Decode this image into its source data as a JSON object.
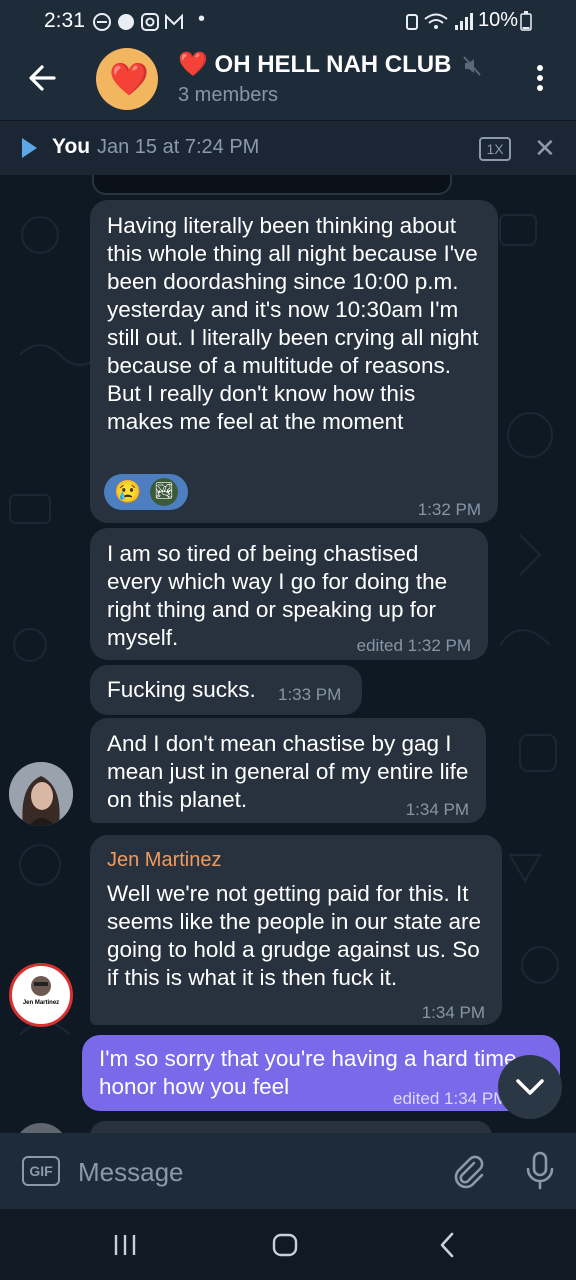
{
  "status_bar": {
    "time": "2:31",
    "dot": "•",
    "battery": "10%"
  },
  "header": {
    "heart_emoji": "❤️",
    "title": "❤️ OH HELL NAH CLUB",
    "members": "3 members"
  },
  "pinned": {
    "sender": "You",
    "date": "Jan 15 at 7:24 PM",
    "speed": "1X"
  },
  "messages": [
    {
      "text": "Having literally been thinking about this whole thing all night because I've been doordashing since 10:00 p.m. yesterday and it's now 10:30am I'm still out. I literally been crying all night because of a multitude of reasons. But I really don't know how this makes me feel at the moment",
      "time": "1:32 PM",
      "reactions": [
        "😢",
        "🏞"
      ]
    },
    {
      "text": "I am so tired of being chastised every which way I go for doing the right thing and or speaking up for myself.",
      "time": "edited 1:32 PM"
    },
    {
      "text": "Fucking sucks.",
      "time": "1:33 PM"
    },
    {
      "text": "And I don't mean chastise by gag I mean just in general of my entire life on this planet.",
      "time": "1:34 PM"
    },
    {
      "sender": "Jen Martinez",
      "text": "Well we're not getting paid for this. It seems like the people in our state are going to hold a grudge against us. So if this is what it is then fuck it.",
      "time": "1:34 PM",
      "avatar_caption": "Jen Martinez"
    },
    {
      "text": "I'm so sorry that you're having a hard time honor how you feel",
      "time": "edited 1:34 PM"
    }
  ],
  "input": {
    "gif_label": "GIF",
    "placeholder": "Message"
  },
  "colors": {
    "accent": "#5ea6e8",
    "outgoing_bubble": "#7a69e8",
    "incoming_bubble": "#27323e",
    "sender_name": "#f2995c",
    "avatar_bg": "#f2b660"
  }
}
